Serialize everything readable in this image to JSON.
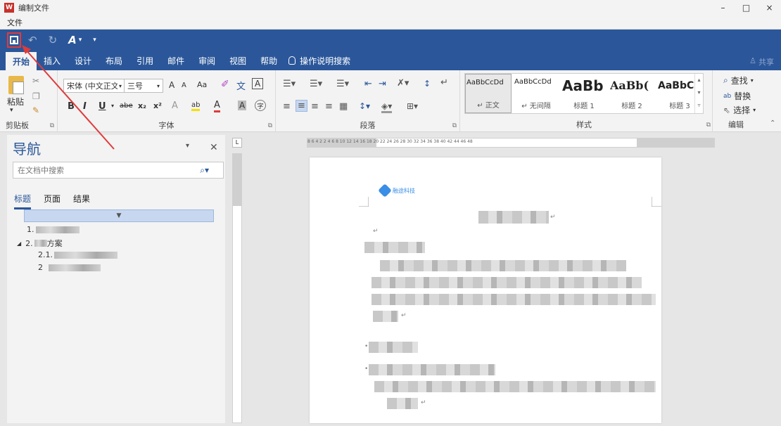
{
  "window": {
    "title": "编制文件",
    "controls": [
      "–",
      "□",
      "×"
    ]
  },
  "file_menu": "文件",
  "ribbon_tabs": [
    "开始",
    "插入",
    "设计",
    "布局",
    "引用",
    "邮件",
    "审阅",
    "视图",
    "帮助"
  ],
  "tell_me": "操作说明搜索",
  "share": "共享",
  "clipboard": {
    "paste": "粘贴",
    "label": "剪贴板"
  },
  "font": {
    "name": "宋体 (中文正文",
    "size": "三号",
    "grow": "A",
    "shrink": "A",
    "case": "Aa",
    "phonetic": "文",
    "border": "A",
    "bold": "B",
    "italic": "I",
    "underline": "U",
    "strike": "abe",
    "sub": "x₂",
    "sup": "x²",
    "effects": "A",
    "highlight": "ab",
    "color": "A",
    "shade": "A",
    "encircle": "字",
    "label": "字体"
  },
  "paragraph": {
    "label": "段落"
  },
  "styles": {
    "label": "样式",
    "items": [
      {
        "sample": "AaBbCcDd",
        "name": "↵ 正文"
      },
      {
        "sample": "AaBbCcDd",
        "name": "↵ 无间隔"
      },
      {
        "sample": "AaBb",
        "name": "标题 1"
      },
      {
        "sample": "AaBb(",
        "name": "标题 2"
      },
      {
        "sample": "AaBbC",
        "name": "标题 3"
      }
    ]
  },
  "editing": {
    "find": "查找",
    "replace": "替换",
    "select": "选择",
    "label": "编辑"
  },
  "nav": {
    "title": "导航",
    "search_placeholder": "在文档中搜索",
    "tabs": [
      "标题",
      "页面",
      "结果"
    ],
    "tree": [
      "1.",
      "2.",
      "方案",
      "2.1.",
      "2"
    ]
  },
  "ruler_h": "8  6  4  2     2  4  6  8  10  12  14  16  18  20  22  24  26  28  30  32  34  36  38  40  42  44  46  48",
  "doc": {
    "logo_text": "融途科技"
  },
  "colors": {
    "accent": "#2b579a",
    "annotation": "#e03b3b"
  }
}
